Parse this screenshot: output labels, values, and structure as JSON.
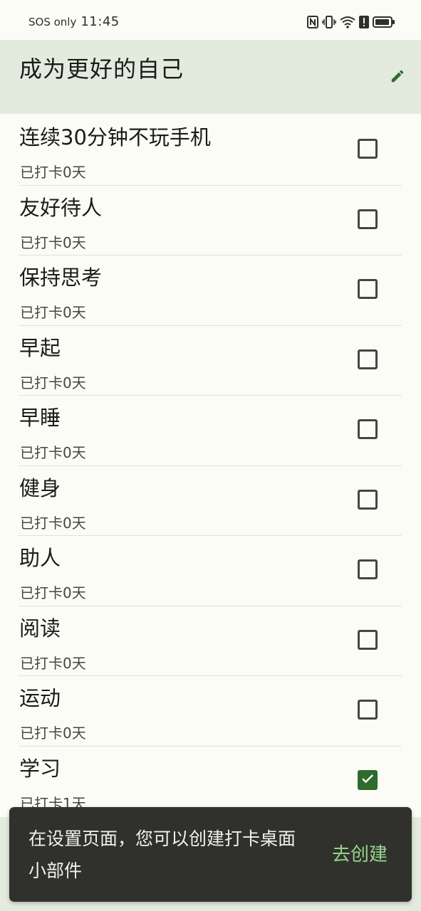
{
  "status_bar": {
    "carrier": "SOS only",
    "time": "11:45",
    "icons": [
      "nfc-icon",
      "vibrate-icon",
      "wifi-icon",
      "alert-icon",
      "battery-icon"
    ]
  },
  "header": {
    "title": "成为更好的自己",
    "edit_icon": "edit-pencil-icon"
  },
  "habits": [
    {
      "title": "连续30分钟不玩手机",
      "subtitle": "已打卡0天",
      "checked": false
    },
    {
      "title": "友好待人",
      "subtitle": "已打卡0天",
      "checked": false
    },
    {
      "title": "保持思考",
      "subtitle": "已打卡0天",
      "checked": false
    },
    {
      "title": "早起",
      "subtitle": "已打卡0天",
      "checked": false
    },
    {
      "title": "早睡",
      "subtitle": "已打卡0天",
      "checked": false
    },
    {
      "title": "健身",
      "subtitle": "已打卡0天",
      "checked": false
    },
    {
      "title": "助人",
      "subtitle": "已打卡0天",
      "checked": false
    },
    {
      "title": "阅读",
      "subtitle": "已打卡0天",
      "checked": false
    },
    {
      "title": "运动",
      "subtitle": "已打卡0天",
      "checked": false
    },
    {
      "title": "学习",
      "subtitle": "已打卡1天",
      "checked": true
    }
  ],
  "snackbar": {
    "message": "在设置页面，您可以创建打卡桌面小部件",
    "action": "去创建"
  },
  "colors": {
    "background": "#fbfcf6",
    "header_bg": "#e2ebdd",
    "accent": "#2e6b2c",
    "snackbar_bg": "#30312d",
    "snackbar_action": "#93d58a"
  }
}
